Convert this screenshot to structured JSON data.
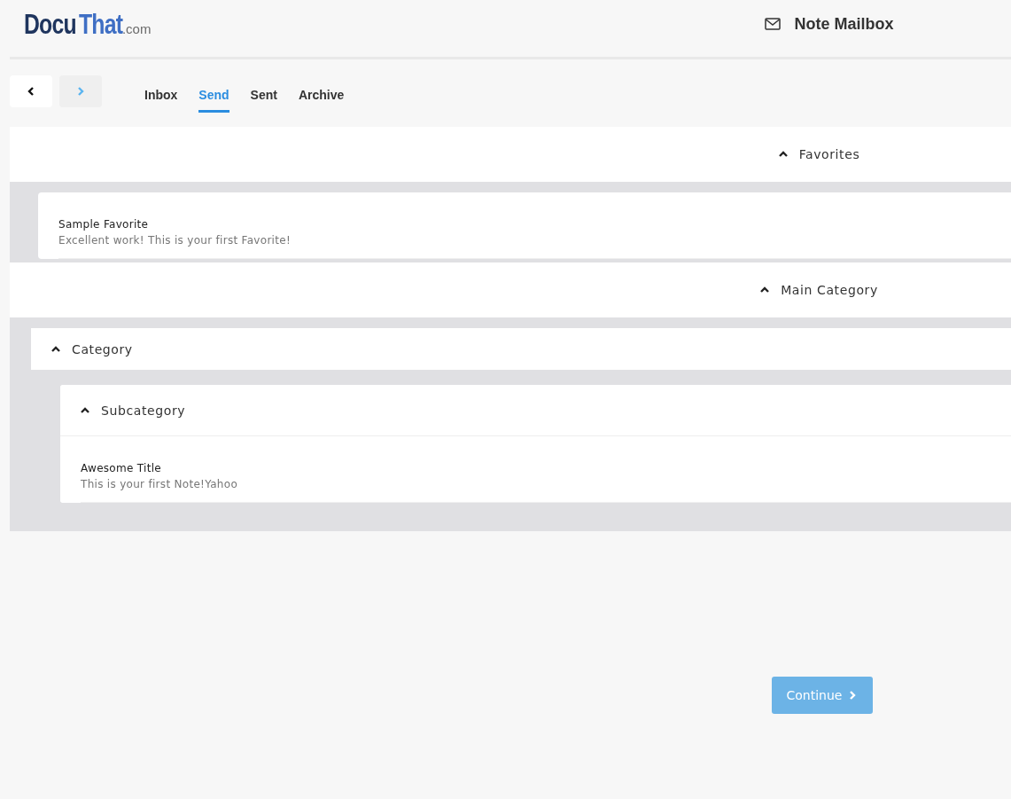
{
  "logo": {
    "parts": [
      {
        "text": "Docu",
        "kind": "dark"
      },
      {
        "text": "That",
        "kind": "accent"
      },
      {
        "text": ".com",
        "kind": "suffix"
      }
    ]
  },
  "mailbox_title": "Note Mailbox",
  "nav_buttons": [
    {
      "kind": "back",
      "disabled": false
    },
    {
      "kind": "forward",
      "disabled": true
    }
  ],
  "tabs": [
    {
      "label": "Inbox",
      "selected": false
    },
    {
      "label": "Send",
      "selected": true
    },
    {
      "label": "Sent",
      "selected": false
    },
    {
      "label": "Archive",
      "selected": false
    }
  ],
  "sections": [
    {
      "title": "Favorites",
      "expanded": true,
      "notes": [
        {
          "title": "Sample Favorite",
          "text": "Excellent work! This is your first Favorite!"
        }
      ]
    },
    {
      "title": "Main Category",
      "expanded": true,
      "children": [
        {
          "title": "Category",
          "expanded": true,
          "children": [
            {
              "title": "Subcategory",
              "expanded": true,
              "notes": [
                {
                  "title": "Awesome Title",
                  "text": "This is your first Note!Yahoo"
                }
              ]
            }
          ]
        }
      ]
    }
  ],
  "continue_button": {
    "label": "Continue"
  }
}
